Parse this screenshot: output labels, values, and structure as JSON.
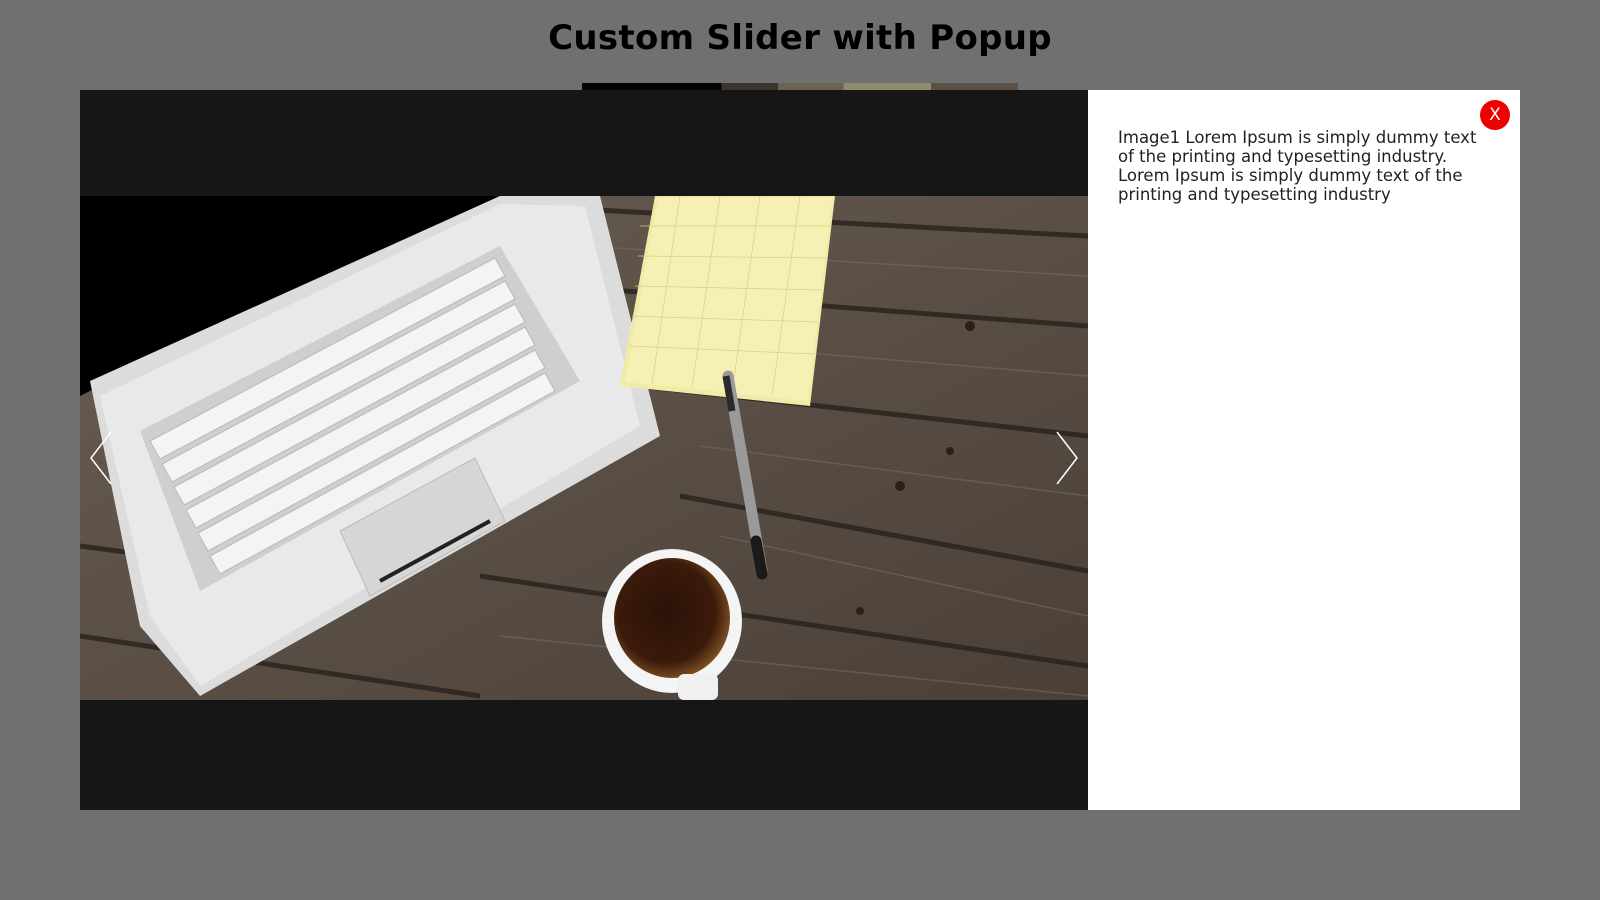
{
  "page": {
    "title": "Custom Slider with Popup"
  },
  "modal": {
    "close_label": "X",
    "description": "Image1 Lorem Ipsum is simply dummy text of the printing and typesetting industry. Lorem Ipsum is simply dummy text of the printing and typesetting industry",
    "prev_icon": "chevron-left-icon",
    "next_icon": "chevron-right-icon",
    "image_subject": "laptop, notepad, pen and coffee on wooden table"
  },
  "colors": {
    "background": "#707070",
    "stage": "#161616",
    "close_button": "#ee0000"
  }
}
